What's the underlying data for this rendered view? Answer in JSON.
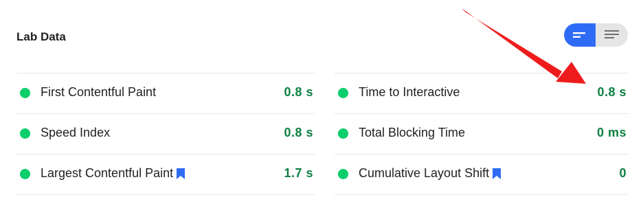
{
  "section": {
    "title": "Lab Data"
  },
  "view_toggle": {
    "active": "summary",
    "icons": [
      "summary-view-icon",
      "detail-view-icon"
    ]
  },
  "colors": {
    "pass": "#0cce6b",
    "value": "#0d8043",
    "accent": "#2f6cf5",
    "bookmark": "#2f6cf5",
    "arrow": "#ee1c1c"
  },
  "metrics_left": [
    {
      "label": "First Contentful Paint",
      "value": "0.8 s",
      "status": "pass",
      "bookmark": false
    },
    {
      "label": "Speed Index",
      "value": "0.8 s",
      "status": "pass",
      "bookmark": false
    },
    {
      "label": "Largest Contentful Paint",
      "value": "1.7 s",
      "status": "pass",
      "bookmark": true
    }
  ],
  "metrics_right": [
    {
      "label": "Time to Interactive",
      "value": "0.8 s",
      "status": "pass",
      "bookmark": false
    },
    {
      "label": "Total Blocking Time",
      "value": "0 ms",
      "status": "pass",
      "bookmark": false
    },
    {
      "label": "Cumulative Layout Shift",
      "value": "0",
      "status": "pass",
      "bookmark": true
    }
  ]
}
